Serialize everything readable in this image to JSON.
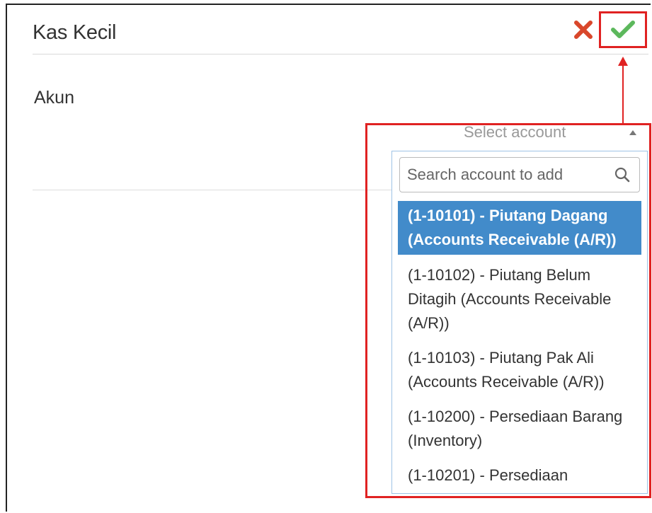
{
  "dialog": {
    "title": "Kas Kecil"
  },
  "form": {
    "account_label": "Akun",
    "account_select": {
      "placeholder": "Select account",
      "search_placeholder": "Search account to add",
      "options": [
        {
          "label": "(1-10101) - Piutang Dagang (Accounts Receivable (A/R))",
          "selected": true
        },
        {
          "label": "(1-10102) - Piutang Belum Ditagih (Accounts Receivable (A/R))",
          "selected": false
        },
        {
          "label": "(1-10103) - Piutang Pak Ali (Accounts Receivable (A/R))",
          "selected": false
        },
        {
          "label": "(1-10200) - Persediaan Barang (Inventory)",
          "selected": false
        },
        {
          "label": "(1-10201) - Persediaan",
          "selected": false
        }
      ]
    }
  },
  "icons": {
    "cancel": "close-icon",
    "save": "check-icon",
    "search": "search-icon",
    "caret": "caret-up-icon"
  },
  "colors": {
    "cancel": "#d9472b",
    "save": "#5cb85c",
    "annotation": "#e02222",
    "selected_option": "#428bca"
  }
}
